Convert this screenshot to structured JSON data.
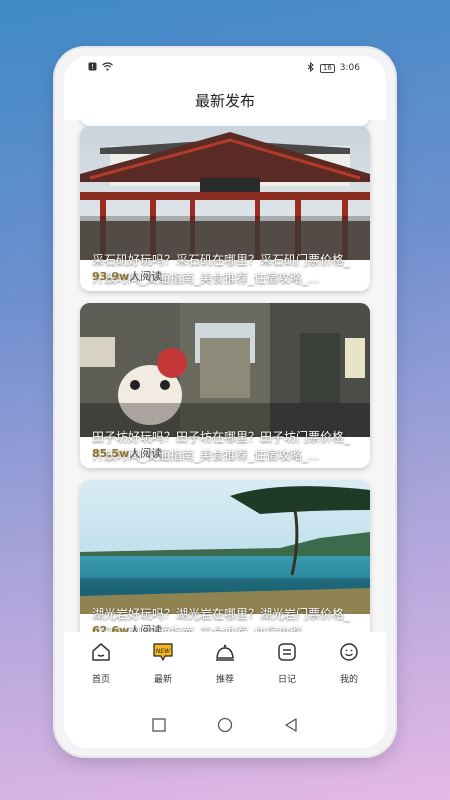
{
  "status_bar": {
    "battery": "16",
    "time": "3:06"
  },
  "header": {
    "title": "最新发布"
  },
  "feed": {
    "items": [
      {
        "title": "采石矶好玩吗？采石矶在哪里？采石矶门票价格_开放时间_交通指南_美食推荐_住宿攻略_...",
        "read_count": "93.9w",
        "read_suffix": "人阅读",
        "image": "pavilion-gate-photo"
      },
      {
        "title": "田子坊好玩吗？田子坊在哪里？田子坊门票价格_开放时间_交通指南_美食推荐_住宿攻略_...",
        "read_count": "85.5w",
        "read_suffix": "人阅读",
        "image": "alley-street-photo"
      },
      {
        "title": "湖光岩好玩吗？湖光岩在哪里？湖光岩门票价格_开放时间_交通指南_美食推荐_住宿攻略_...",
        "read_count": "62.6w",
        "read_suffix": "人阅读",
        "image": "lake-view-photo"
      }
    ]
  },
  "tabbar": {
    "items": [
      {
        "label": "首页",
        "icon": "home-icon"
      },
      {
        "label": "最新",
        "icon": "new-badge-icon",
        "badge": "NEW"
      },
      {
        "label": "推荐",
        "icon": "recommend-icon"
      },
      {
        "label": "日记",
        "icon": "diary-icon"
      },
      {
        "label": "我的",
        "icon": "profile-icon"
      }
    ]
  },
  "colors": {
    "accent": "#f5b81b",
    "read_count": "#8a7430"
  }
}
